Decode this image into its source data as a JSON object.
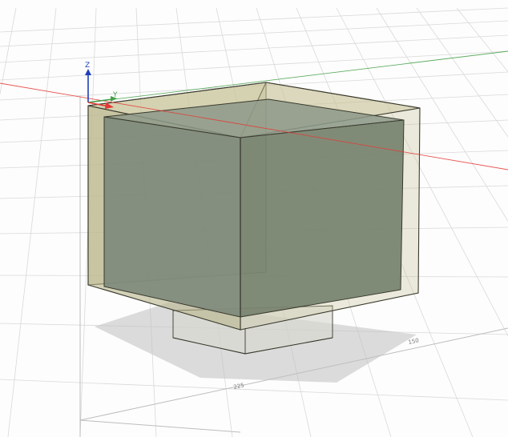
{
  "viewport": {
    "background": "#fdfdfd",
    "grid_color": "#d9d9d9",
    "grid_major_color": "#bdbdbd"
  },
  "axes": {
    "x_color": "#e53935",
    "y_color": "#43a047",
    "z_color": "#1e3fbf",
    "z_label": "Z",
    "y_label": "Y"
  },
  "rulers": {
    "right_label": "150",
    "front_label": "225"
  },
  "model": {
    "outer_shell_color": "#c8c49a",
    "inner_block_color": "#7e8a7c",
    "edge_color": "#3a3a2e",
    "shadow_color": "#bfbfbf"
  }
}
